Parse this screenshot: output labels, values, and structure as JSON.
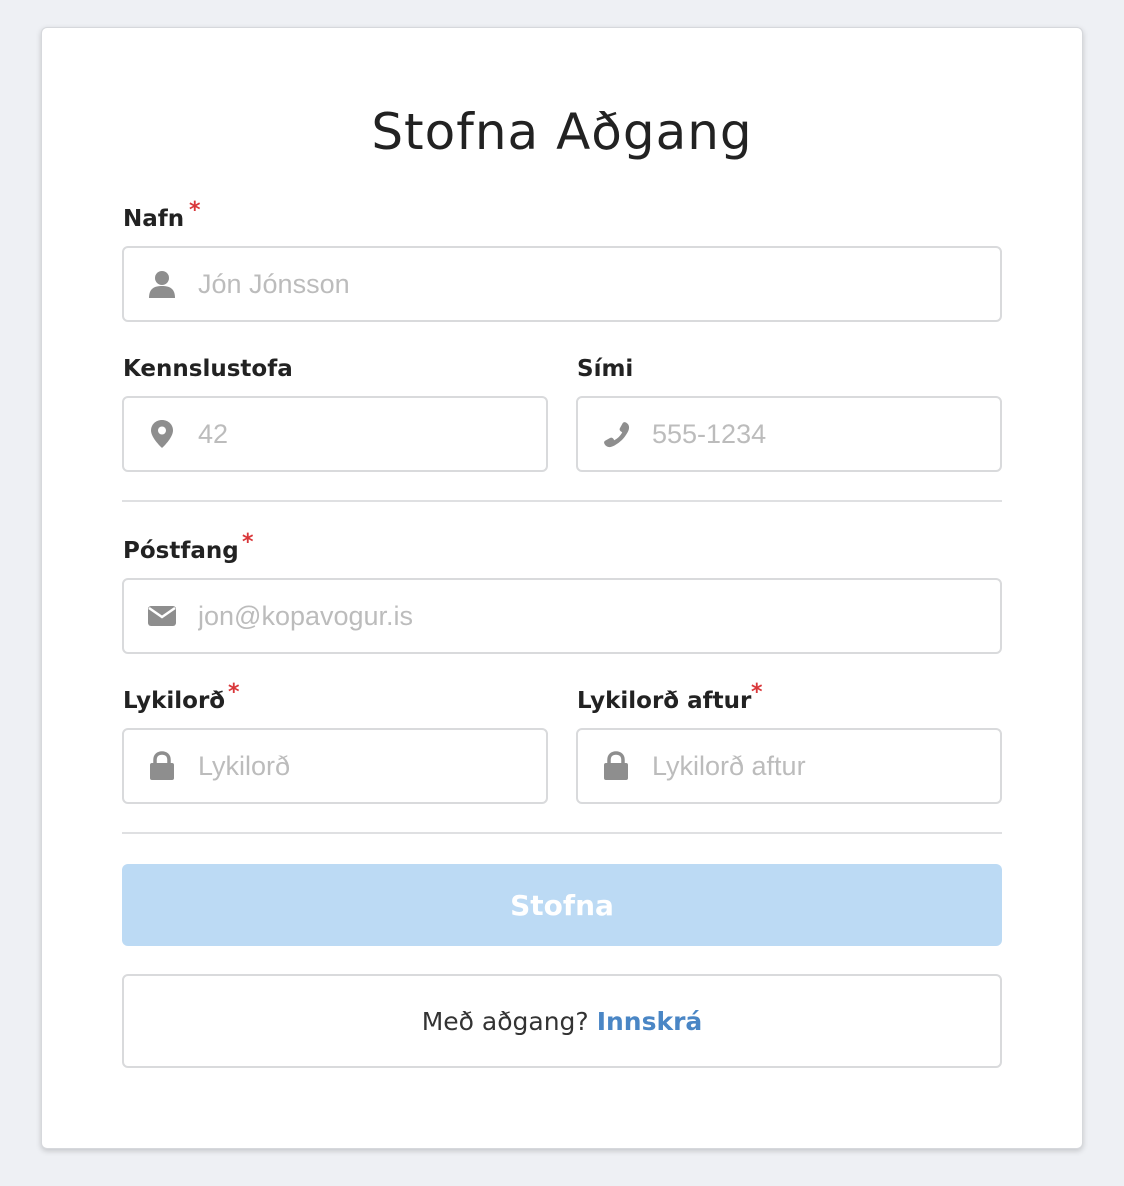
{
  "form": {
    "title": "Stofna Aðgang",
    "required_marker": "*",
    "name": {
      "label": "Nafn",
      "placeholder": "Jón Jónsson",
      "icon": "user-icon"
    },
    "classroom": {
      "label": "Kennslustofa",
      "placeholder": "42",
      "icon": "map-marker-icon"
    },
    "phone": {
      "label": "Sími",
      "placeholder": "555-1234",
      "icon": "phone-icon"
    },
    "email": {
      "label": "Póstfang",
      "placeholder": "jon@kopavogur.is",
      "icon": "envelope-icon"
    },
    "password": {
      "label": "Lykilorð",
      "placeholder": "Lykilorð",
      "icon": "lock-icon"
    },
    "password_confirm": {
      "label": "Lykilorð aftur",
      "placeholder": "Lykilorð aftur",
      "icon": "lock-icon"
    },
    "submit_label": "Stofna",
    "login_prompt": "Með aðgang?",
    "login_link": "Innskrá"
  },
  "colors": {
    "background": "#eef0f4",
    "required": "#d9373a",
    "submit_disabled": "#bcdaf4",
    "link": "#4a86c5",
    "icon": "#8e8e8e"
  }
}
